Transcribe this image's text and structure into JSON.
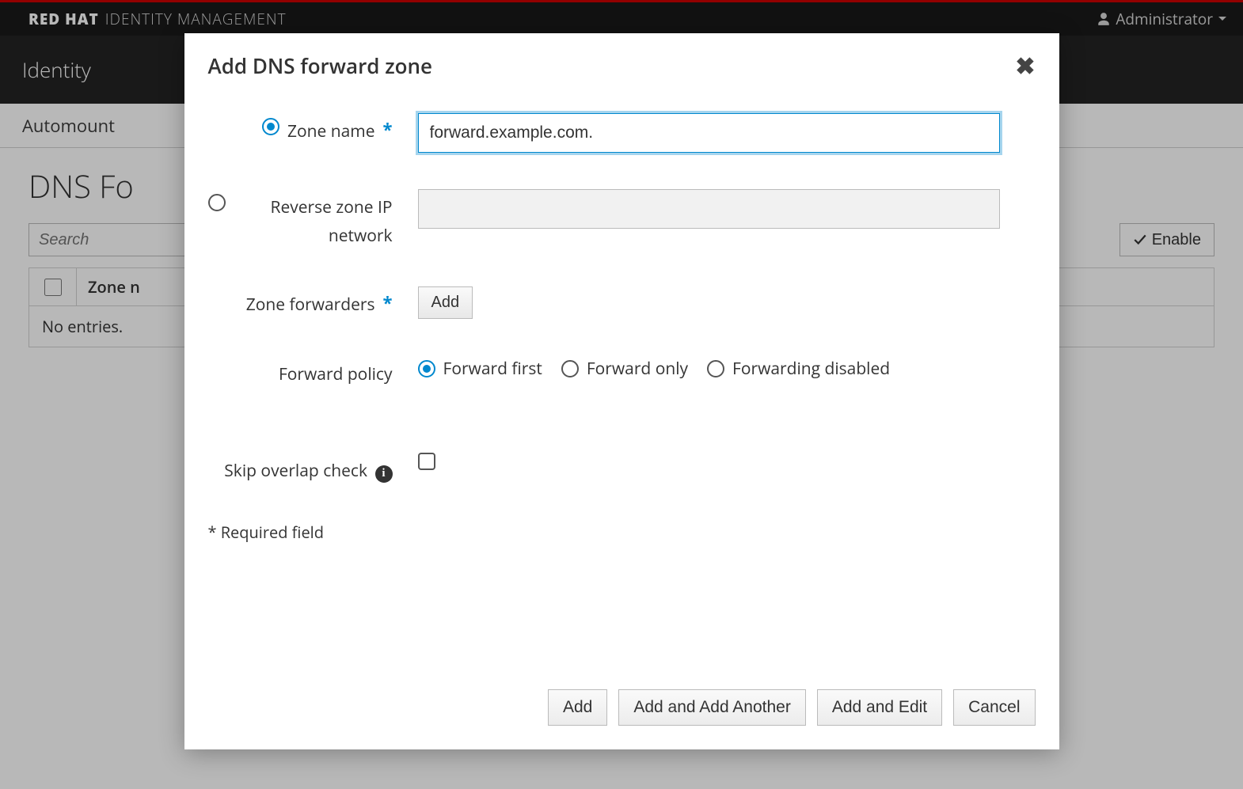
{
  "brand": {
    "primary": "RED HAT",
    "secondary": "IDENTITY MANAGEMENT"
  },
  "user": {
    "name": "Administrator"
  },
  "nav": {
    "primary": "Identity"
  },
  "tabs": {
    "active": "Automount"
  },
  "page": {
    "title": "DNS Fo",
    "search_placeholder": "Search",
    "enable_btn": "Enable",
    "table": {
      "col_zone": "Zone n",
      "empty": "No entries."
    }
  },
  "modal": {
    "title": "Add DNS forward zone",
    "fields": {
      "zone_name_label": "Zone name",
      "zone_name_value": "forward.example.com.",
      "reverse_label": "Reverse zone IP network",
      "forwarders_label": "Zone forwarders",
      "forwarders_add": "Add",
      "policy_label": "Forward policy",
      "policy_options": {
        "first": "Forward first",
        "only": "Forward only",
        "disabled": "Forwarding disabled"
      },
      "skip_label": "Skip overlap check"
    },
    "required_note": "* Required field",
    "footer": {
      "add": "Add",
      "add_another": "Add and Add Another",
      "add_edit": "Add and Edit",
      "cancel": "Cancel"
    }
  }
}
